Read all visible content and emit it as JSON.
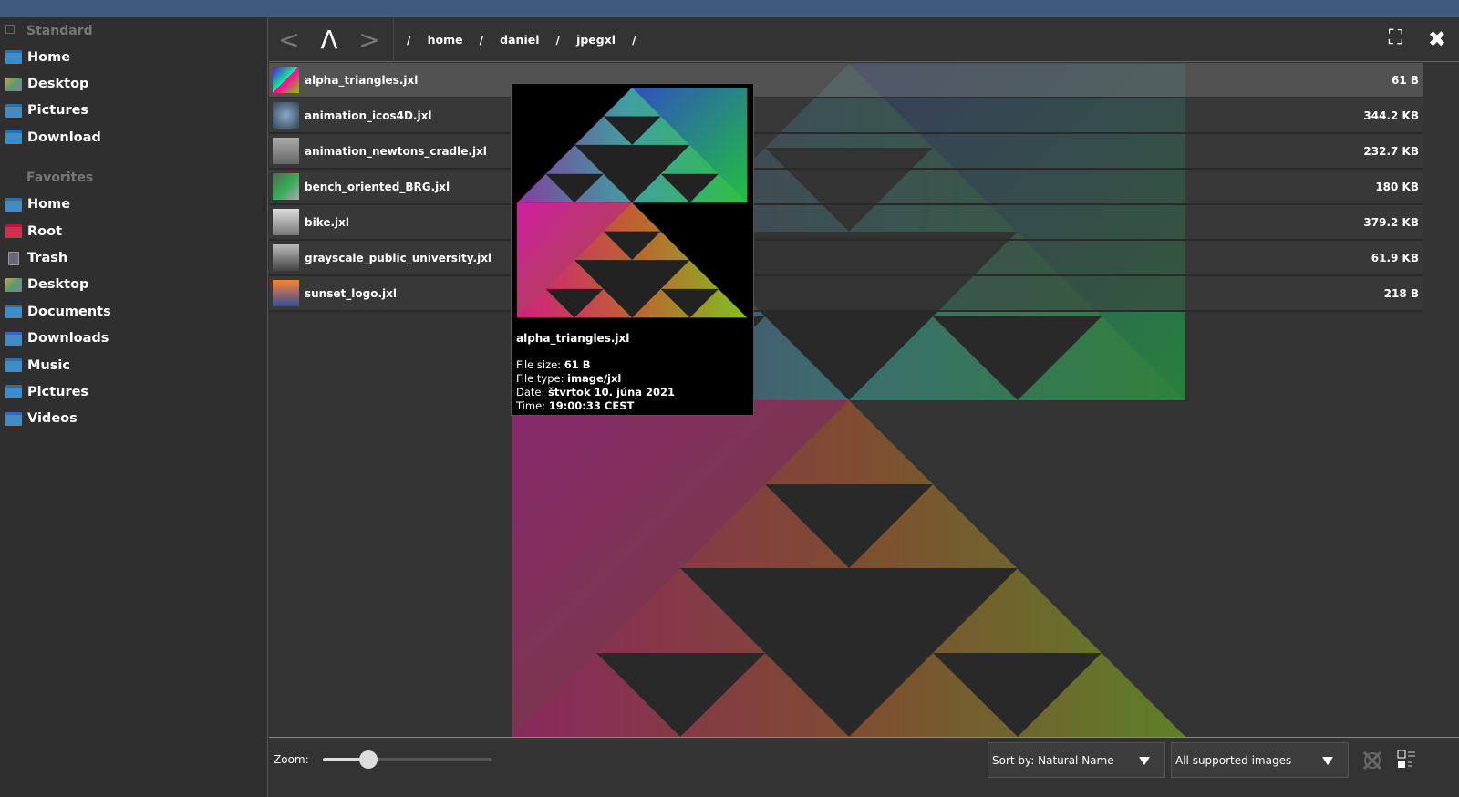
{
  "sidebar": {
    "standard_label": "Standard",
    "standard": [
      {
        "label": "Home",
        "icon": "folder-home-icon"
      },
      {
        "label": "Desktop",
        "icon": "desktop-icon"
      },
      {
        "label": "Pictures",
        "icon": "folder-pictures-icon"
      },
      {
        "label": "Download",
        "icon": "folder-icon"
      }
    ],
    "favorites_label": "Favorites",
    "favorites": [
      {
        "label": "Home",
        "icon": "folder-home-icon"
      },
      {
        "label": "Root",
        "icon": "folder-root-icon"
      },
      {
        "label": "Trash",
        "icon": "trash-icon"
      },
      {
        "label": "Desktop",
        "icon": "desktop-icon"
      },
      {
        "label": "Documents",
        "icon": "folder-icon"
      },
      {
        "label": "Downloads",
        "icon": "folder-icon"
      },
      {
        "label": "Music",
        "icon": "folder-icon"
      },
      {
        "label": "Pictures",
        "icon": "folder-pictures-icon"
      },
      {
        "label": "Videos",
        "icon": "folder-icon"
      }
    ]
  },
  "toolbar": {
    "back": "<",
    "up": "Λ",
    "forward": ">",
    "breadcrumb": [
      "/",
      "home",
      "/",
      "daniel",
      "/",
      "jpegxl",
      "/"
    ],
    "fullscreen": "⛶",
    "close": "✖"
  },
  "files": [
    {
      "name": "alpha_triangles.jxl",
      "size": "61 B"
    },
    {
      "name": "animation_icos4D.jxl",
      "size": "344.2 KB"
    },
    {
      "name": "animation_newtons_cradle.jxl",
      "size": "232.7 KB"
    },
    {
      "name": "bench_oriented_BRG.jxl",
      "size": "180 KB"
    },
    {
      "name": "bike.jxl",
      "size": "379.2 KB"
    },
    {
      "name": "grayscale_public_university.jxl",
      "size": "61.9 KB"
    },
    {
      "name": "sunset_logo.jxl",
      "size": "218 B"
    }
  ],
  "tooltip": {
    "title": "alpha_triangles.jxl",
    "size_label": "File size:",
    "size": "61 B",
    "type_label": "File type:",
    "type": "image/jxl",
    "date_label": "Date:",
    "date": "štvrtok 10. júna 2021",
    "time_label": "Time:",
    "time": "19:00:33 CEST"
  },
  "bottom": {
    "zoom_label": "Zoom:",
    "zoom_percent": 27,
    "sort": "Sort by: Natural Name",
    "filter": "All supported images"
  },
  "colors": {
    "topbar": "#3d5a7e",
    "folder": "#3f8cc4"
  }
}
